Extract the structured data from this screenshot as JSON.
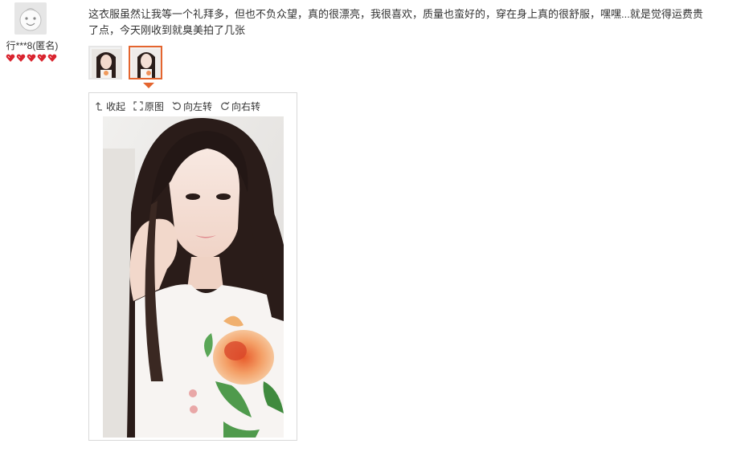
{
  "review": {
    "avatar_icon": "cartoon-face-avatar",
    "username": "行***8(匿名)",
    "rating_hearts": 5,
    "heart_color": "#d9232e",
    "comment_line1": "这衣服虽然让我等一个礼拜多，但也不负众望，真的很漂亮，我很喜欢，质量也蛮好的，穿在身上真的很舒服，嘿嘿...就是觉得运费贵",
    "comment_line2": "了点，今天刚收到就臭美拍了几张"
  },
  "gallery": {
    "active_thumb": 2,
    "accent_color": "#e4652f",
    "thumbnails": [
      "photo-thumbnail-1",
      "photo-thumbnail-2"
    ]
  },
  "viewer": {
    "toolbar": {
      "collapse_label": "收起",
      "original_label": "原图",
      "rotate_left_label": "向左转",
      "rotate_right_label": "向右转"
    }
  }
}
